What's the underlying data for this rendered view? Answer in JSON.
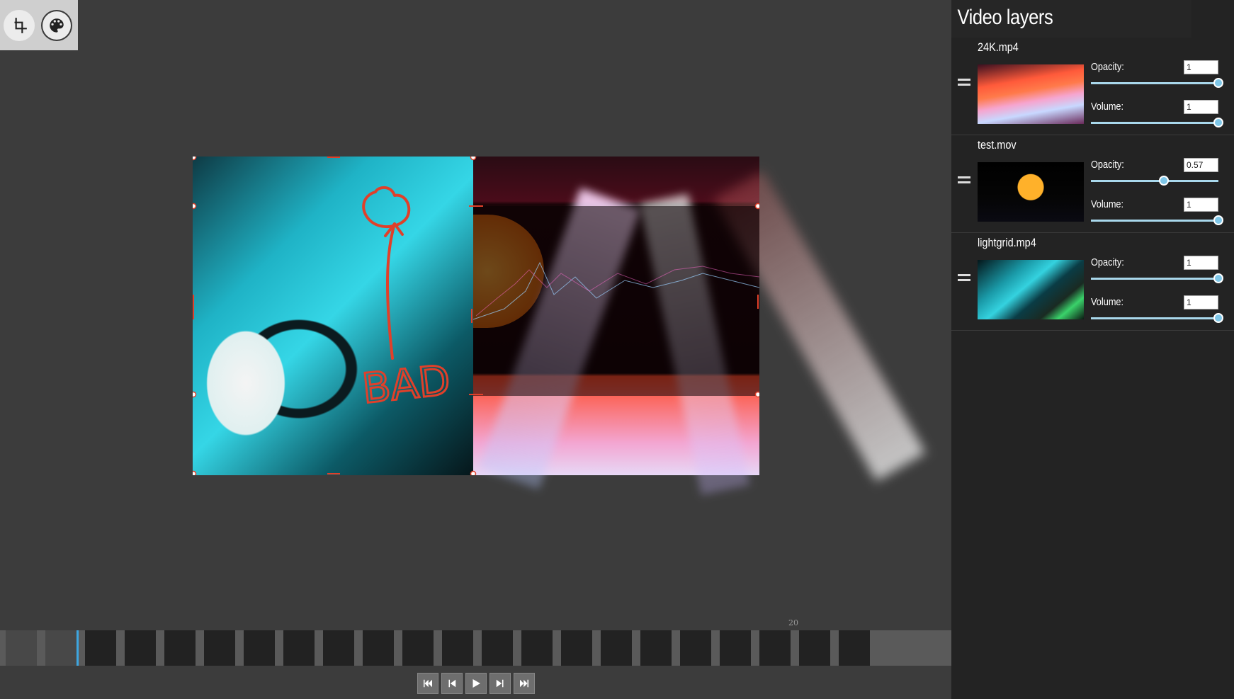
{
  "toolbar": {
    "tools": [
      {
        "icon": "crop-icon",
        "active": false
      },
      {
        "icon": "palette-icon",
        "active": true
      }
    ]
  },
  "canvas": {
    "annotation_text": "BAD",
    "colors": {
      "handle": "#e0402a",
      "annotation": "#e0402a"
    }
  },
  "timeline": {
    "ruler_label": "20",
    "frame_count": 22,
    "empty_frames": 2,
    "playhead_frame": 2
  },
  "transport": {
    "buttons": [
      "skip-to-start-icon",
      "step-back-icon",
      "play-icon",
      "step-forward-icon",
      "skip-to-end-icon"
    ]
  },
  "panel": {
    "title": "Video layers",
    "layers": [
      {
        "name": "24K.mp4",
        "opacity_label": "Opacity:",
        "opacity": "1",
        "opacity_level": 1.0,
        "volume_label": "Volume:",
        "volume": "1",
        "volume_level": 1.0
      },
      {
        "name": "test.mov",
        "opacity_label": "Opacity:",
        "opacity": "0.57",
        "opacity_level": 0.57,
        "volume_label": "Volume:",
        "volume": "1",
        "volume_level": 1.0
      },
      {
        "name": "lightgrid.mp4",
        "opacity_label": "Opacity:",
        "opacity": "1",
        "opacity_level": 1.0,
        "volume_label": "Volume:",
        "volume": "1",
        "volume_level": 1.0
      }
    ]
  }
}
